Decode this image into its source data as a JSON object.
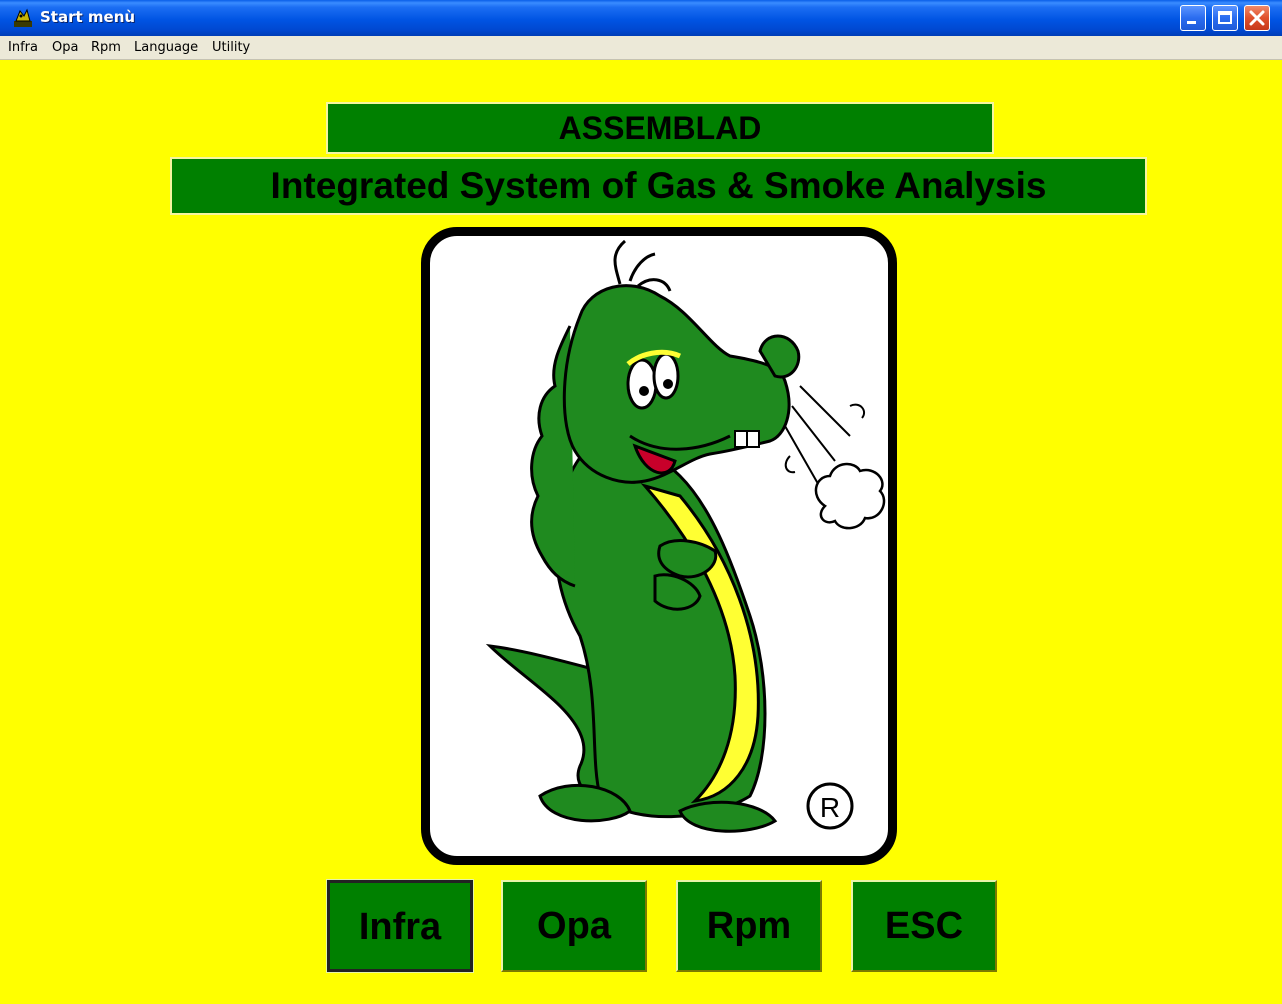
{
  "window": {
    "title": "Start menù"
  },
  "menu": {
    "items": [
      {
        "label": "Infra"
      },
      {
        "label": "Opa"
      },
      {
        "label": "Rpm"
      },
      {
        "label": "Language"
      },
      {
        "label": "Utility"
      }
    ]
  },
  "header": {
    "brand": "ASSEMBLAD",
    "subtitle": "Integrated System of Gas & Smoke Analysis"
  },
  "logo": {
    "icon": "dragon-mascot-icon",
    "registered_mark": "R"
  },
  "buttons": {
    "infra": "Infra",
    "opa": "Opa",
    "rpm": "Rpm",
    "esc": "ESC"
  },
  "colors": {
    "background": "#ffff00",
    "panel_green": "#008000",
    "titlebar_blue": "#0054e3"
  }
}
